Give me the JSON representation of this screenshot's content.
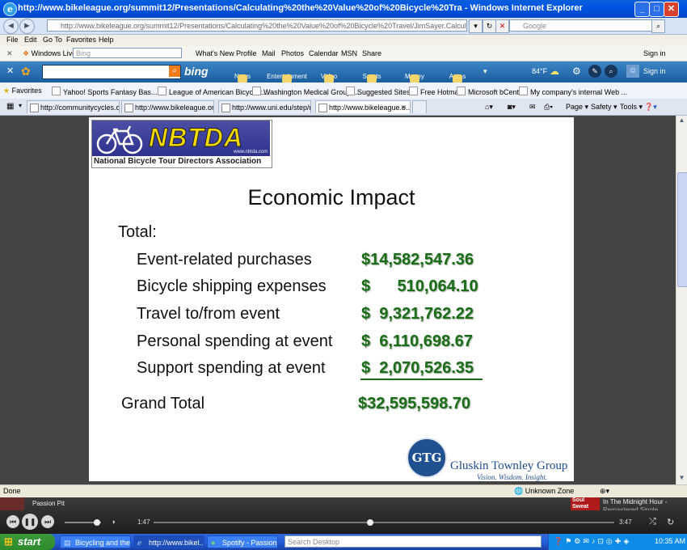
{
  "window": {
    "title": "http://www.bikeleague.org/summit12/Presentations/Calculating%20the%20Value%20of%20Bicycle%20Tra - Windows Internet Explorer",
    "address": "http://www.bikeleague.org/summit12/Presentations/Calculating%20the%20Value%20of%20Bicycle%20Travel/JimSayer.Calculating%20the%20Value%20of",
    "search_placeholder": "Google"
  },
  "menu": [
    "File",
    "Edit",
    "Go To",
    "Favorites",
    "Help"
  ],
  "windows_live": {
    "label": "Windows Live",
    "search_placeholder": "Bing",
    "links": [
      "What's New",
      "Profile",
      "Mail",
      "Photos",
      "Calendar",
      "MSN",
      "Share"
    ],
    "sign_in": "Sign in"
  },
  "bing_bar": {
    "logo": "bing",
    "buttons": [
      "News",
      "Entertainment",
      "Video",
      "Sports",
      "Money",
      "Autos"
    ],
    "weather": "84°F",
    "sign_in": "Sign in"
  },
  "favorites": {
    "label": "Favorites",
    "items": [
      "Yahoo! Sports Fantasy Bas...",
      "League of American Bicyclist...",
      "Washington Medical Group ...",
      "Suggested Sites",
      "Free Hotmail",
      "Microsoft bCentral",
      "My company's internal Web ..."
    ]
  },
  "tabs": [
    {
      "label": "http://communitycycles.org/i..."
    },
    {
      "label": "http://www.bikeleague.org/s..."
    },
    {
      "label": "http://www.uni.edu/step/re..."
    },
    {
      "label": "http://www.bikeleague.o..."
    }
  ],
  "commands": {
    "page": "Page",
    "safety": "Safety",
    "tools": "Tools"
  },
  "slide": {
    "logo_word": "NBTDA",
    "logo_url": "www.nbtda.com",
    "logo_subtitle": "National Bicycle Tour Directors Association",
    "title": "Economic Impact",
    "total_label": "Total:",
    "rows": [
      {
        "label": "Event-related purchases",
        "amount": "$14,582,547.36"
      },
      {
        "label": "Bicycle shipping expenses",
        "amount": "$      510,064.10"
      },
      {
        "label": "Travel to/from event",
        "amount": "$  9,321,762.22"
      },
      {
        "label": "Personal spending at event",
        "amount": "$  6,110,698.67"
      },
      {
        "label": "Support spending at event",
        "amount": "$  2,070,526.35"
      }
    ],
    "grand_total_label": "Grand Total",
    "grand_total_amount": "$32,595,598.70",
    "gtg_mark": "GTG",
    "gtg_name": "Gluskin Townley Group",
    "gtg_tagline": "Vision. Wisdom. Insight."
  },
  "status": {
    "text": "Done",
    "zone": "Unknown Zone"
  },
  "player": {
    "playlist": "Passion Pit",
    "elapsed": "1:47",
    "duration": "3:47",
    "album_text": "Soul Sweat",
    "track_title": "In The Midnight Hour -",
    "track_subtitle": "Remastered Single...",
    "progress": 0.47
  },
  "taskbar": {
    "start": "start",
    "items": [
      "Bicycling and the ...",
      "http://www.bikel...",
      "Spotify - Passion ..."
    ],
    "search_placeholder": "Search Desktop",
    "clock": "10:35 AM"
  },
  "colors": {
    "amount_green": "#1a6e17",
    "gtg_blue": "#1f4d8d",
    "nbtda_yellow": "#f2d800"
  }
}
